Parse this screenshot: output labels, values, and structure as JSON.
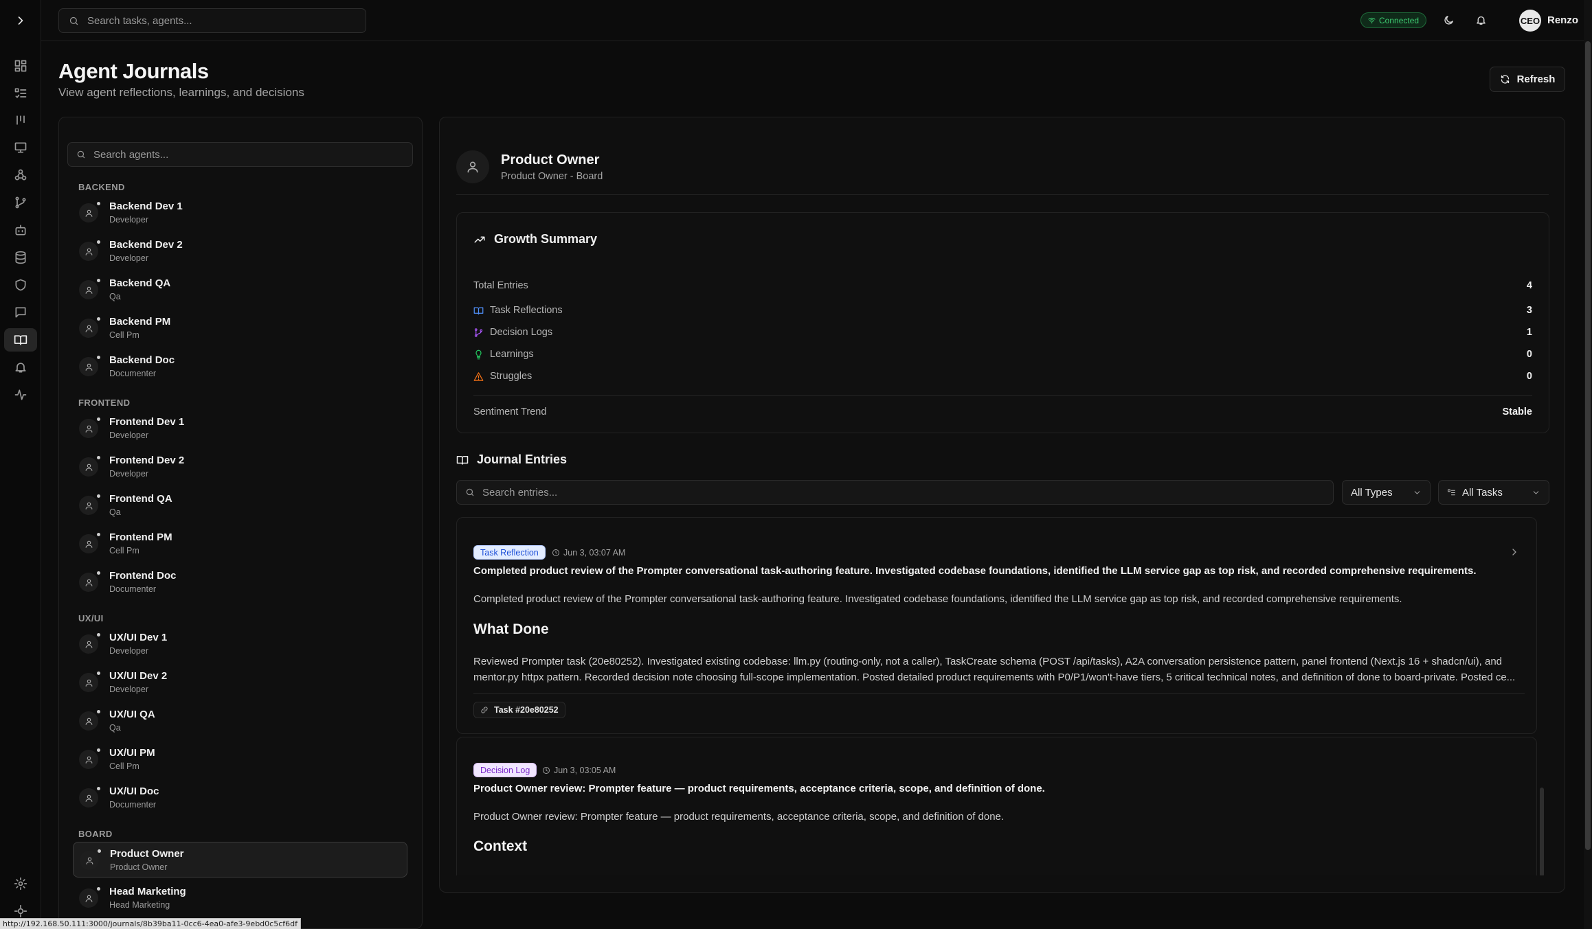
{
  "topbar": {
    "search_placeholder": "Search tasks, agents...",
    "connection_status": "Connected",
    "user_avatar": "CEO",
    "user_name": "Renzo"
  },
  "rail": {
    "items": [
      {
        "icon": "dashboard-icon"
      },
      {
        "icon": "task-list-icon"
      },
      {
        "icon": "kanban-icon"
      },
      {
        "icon": "monitor-icon"
      },
      {
        "icon": "agents-network-icon"
      },
      {
        "icon": "git-branch-icon"
      },
      {
        "icon": "bot-icon"
      },
      {
        "icon": "database-icon"
      },
      {
        "icon": "shield-icon"
      },
      {
        "icon": "chat-icon"
      },
      {
        "icon": "journal-book-icon",
        "active": true
      },
      {
        "icon": "bell-icon"
      },
      {
        "icon": "activity-icon"
      },
      {
        "icon": "settings-icon"
      },
      {
        "icon": "gear-icon"
      }
    ]
  },
  "header": {
    "title": "Agent Journals",
    "subtitle": "View agent reflections, learnings, and decisions",
    "refresh_label": "Refresh"
  },
  "agents_panel": {
    "search_placeholder": "Search agents...",
    "groups": [
      {
        "label": "BACKEND",
        "agents": [
          {
            "name": "Backend Dev 1",
            "role": "Developer"
          },
          {
            "name": "Backend Dev 2",
            "role": "Developer"
          },
          {
            "name": "Backend QA",
            "role": "Qa"
          },
          {
            "name": "Backend PM",
            "role": "Cell Pm"
          },
          {
            "name": "Backend Doc",
            "role": "Documenter"
          }
        ]
      },
      {
        "label": "FRONTEND",
        "agents": [
          {
            "name": "Frontend Dev 1",
            "role": "Developer"
          },
          {
            "name": "Frontend Dev 2",
            "role": "Developer"
          },
          {
            "name": "Frontend QA",
            "role": "Qa"
          },
          {
            "name": "Frontend PM",
            "role": "Cell Pm"
          },
          {
            "name": "Frontend Doc",
            "role": "Documenter"
          }
        ]
      },
      {
        "label": "UX/UI",
        "agents": [
          {
            "name": "UX/UI Dev 1",
            "role": "Developer"
          },
          {
            "name": "UX/UI Dev 2",
            "role": "Developer"
          },
          {
            "name": "UX/UI QA",
            "role": "Qa"
          },
          {
            "name": "UX/UI PM",
            "role": "Cell Pm"
          },
          {
            "name": "UX/UI Doc",
            "role": "Documenter"
          }
        ]
      },
      {
        "label": "BOARD",
        "agents": [
          {
            "name": "Product Owner",
            "role": "Product Owner",
            "selected": true
          },
          {
            "name": "Head Marketing",
            "role": "Head Marketing"
          }
        ]
      }
    ]
  },
  "detail": {
    "agent_name": "Product Owner",
    "agent_sub": "Product Owner - Board",
    "growth": {
      "title": "Growth Summary",
      "total_label": "Total Entries",
      "total_value": "4",
      "rows": [
        {
          "label": "Task Reflections",
          "value": "3",
          "icon": "book-icon",
          "color": "#4f8df5"
        },
        {
          "label": "Decision Logs",
          "value": "1",
          "icon": "git-branch-icon",
          "color": "#a855f7"
        },
        {
          "label": "Learnings",
          "value": "0",
          "icon": "lightbulb-icon",
          "color": "#22c55e"
        },
        {
          "label": "Struggles",
          "value": "0",
          "icon": "warning-icon",
          "color": "#f97316"
        }
      ],
      "sentiment_label": "Sentiment Trend",
      "sentiment_value": "Stable"
    },
    "journal": {
      "title": "Journal Entries",
      "search_placeholder": "Search entries...",
      "type_filter": "All Types",
      "task_filter": "All Tasks"
    },
    "entries": [
      {
        "badge": "Task Reflection",
        "time": "Jun 3, 03:07 AM",
        "title": "Completed product review of the Prompter conversational task-authoring feature. Investigated codebase foundations, identified the LLM service gap as top risk, and recorded comprehensive requirements.",
        "summary": "Completed product review of the Prompter conversational task-authoring feature. Investigated codebase foundations, identified the LLM service gap as top risk, and recorded comprehensive requirements.",
        "section_heading": "What Done",
        "paragraph_line1": "Reviewed Prompter task (20e80252). Investigated existing codebase: llm.py (routing-only, not a caller), TaskCreate schema (POST /api/tasks), A2A conversation persistence pattern, panel frontend (Next.js 16 + shadcn/ui), and",
        "paragraph_line2": "mentor.py httpx pattern. Recorded decision note choosing full-scope implementation. Posted detailed product requirements with P0/P1/won't-have tiers, 5 critical technical notes, and definition of done to board-private. Posted ce...",
        "task_link": "Task #20e80252"
      },
      {
        "badge": "Decision Log",
        "time": "Jun 3, 03:05 AM",
        "title": "Product Owner review: Prompter feature — product requirements, acceptance criteria, scope, and definition of done.",
        "summary": "Product Owner review: Prompter feature — product requirements, acceptance criteria, scope, and definition of done.",
        "section_heading": "Context"
      }
    ]
  },
  "status_url": "http://192.168.50.111:3000/journals/8b39ba11-0cc6-4ea0-afe3-9ebd0c5cf6df"
}
